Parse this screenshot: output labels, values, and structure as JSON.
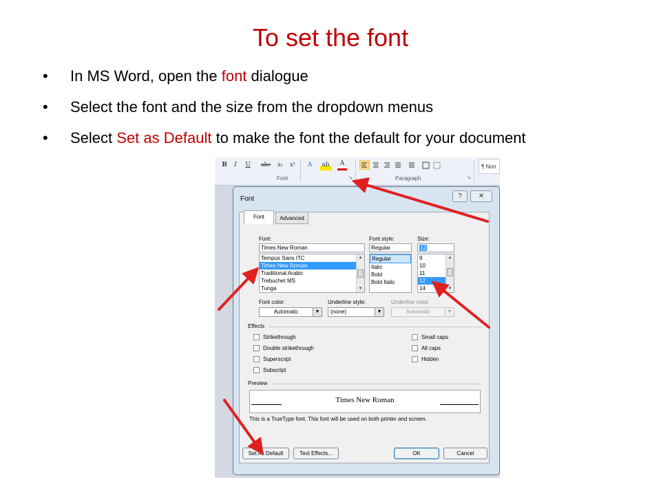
{
  "slide": {
    "title": "To set the font",
    "bullets": [
      {
        "text_before": "In MS Word, open the ",
        "highlight": "font",
        "text_after": " dialogue"
      },
      {
        "text": "Select the font and the size from the dropdown menus"
      },
      {
        "text_before": "Select ",
        "highlight": "Set as Default",
        "text_after": " to make the font the default for your document"
      }
    ]
  },
  "colors": {
    "accent_red": "#c00000",
    "arrow_red": "#e02020",
    "selection_blue": "#3399ff"
  },
  "ribbon": {
    "buttons": [
      "B",
      "I",
      "U",
      "abc",
      "x₂",
      "x²",
      "A",
      "ab",
      "A"
    ],
    "groups": {
      "font": "Font",
      "paragraph": "Paragraph"
    },
    "style_box": "¶ Norr"
  },
  "dialog": {
    "title": "Font",
    "help": "?",
    "close": "✕",
    "tabs": {
      "font": "Font",
      "advanced": "Advanced"
    },
    "font": {
      "label": "Font:",
      "value": "Times New Roman",
      "list": [
        "Tempus Sans ITC",
        "Times New Roman",
        "Traditional Arabic",
        "Trebuchet MS",
        "Tunga"
      ],
      "selected": "Times New Roman"
    },
    "style": {
      "label": "Font style:",
      "value": "Regular",
      "list": [
        "Regular",
        "Italic",
        "Bold",
        "Bold Italic"
      ],
      "selected": "Regular"
    },
    "size": {
      "label": "Size:",
      "value": "12",
      "list": [
        "9",
        "10",
        "11",
        "12",
        "14"
      ],
      "selected": "12"
    },
    "font_color": {
      "label": "Font color:",
      "value": "Automatic"
    },
    "underline_style": {
      "label": "Underline style:",
      "value": "(none)"
    },
    "underline_color": {
      "label": "Underline color:",
      "value": "Automatic"
    },
    "effects": {
      "label": "Effects",
      "left": [
        "Strikethrough",
        "Double strikethrough",
        "Superscript",
        "Subscript"
      ],
      "right": [
        "Small caps",
        "All caps",
        "Hidden"
      ]
    },
    "preview": {
      "label": "Preview",
      "sample": "Times New Roman",
      "note": "This is a TrueType font. This font will be used on both printer and screen."
    },
    "buttons": {
      "set_default": "Set As Default",
      "text_effects": "Text Effects...",
      "ok": "OK",
      "cancel": "Cancel"
    }
  }
}
